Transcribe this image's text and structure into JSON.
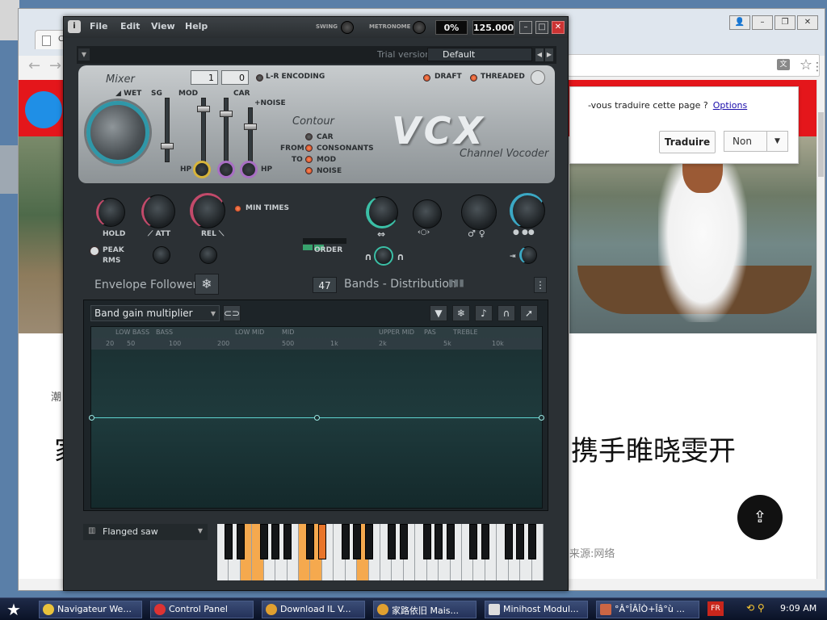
{
  "browser": {
    "tab_title": "Ch",
    "page_small_text": "潮",
    "headline_left": "家",
    "headline": "携手睢晓雯开",
    "source_text": "来源:网络",
    "translate": {
      "question": "-vous traduire cette page ?",
      "options_link": "Options",
      "translate_button": "Traduire",
      "no_button": "Non"
    }
  },
  "plugin": {
    "menu": [
      "File",
      "Edit",
      "View",
      "Help"
    ],
    "swing_label": "SWING",
    "metronome_label": "METRONOME",
    "cpu_readout": "0%",
    "tempo_readout": "125.000",
    "trial_label": "Trial version",
    "preset_name": "Default",
    "mixer": {
      "title": "Mixer",
      "wet_label": "WET",
      "sg_label": "SG",
      "mod_label": "MOD",
      "car_label": "CAR",
      "noise_label": "+NOISE",
      "hp_left": "HP",
      "hp_right": "HP",
      "num1": "1",
      "num2": "0"
    },
    "lr_encoding_label": "L-R ENCODING",
    "draft_label": "DRAFT",
    "threaded_label": "THREADED",
    "contour": {
      "title": "Contour",
      "from_label": "FROM",
      "to_label": "TO",
      "options": [
        "CAR",
        "CONSONANTS",
        "MOD",
        "NOISE"
      ]
    },
    "logo_text": "VCX",
    "logo_sub": "Channel Vocoder",
    "envelope": {
      "hold_label": "HOLD",
      "att_label": "ATT",
      "rel_label": "REL",
      "min_times_label": "MIN TIMES",
      "peak_label": "PEAK",
      "rms_label": "RMS",
      "title": "Envelope Follower"
    },
    "order_label": "ORDER",
    "bands_count": "47",
    "bands_label": "Bands - Distribution",
    "graph": {
      "dropdown": "Band gain multiplier",
      "band_names": [
        "LOW BASS",
        "BASS",
        "LOW MID",
        "MID",
        "UPPER MID",
        "PAS",
        "TREBLE"
      ],
      "freq_labels": [
        "20",
        "50",
        "100",
        "200",
        "500",
        "1k",
        "2k",
        "5k",
        "10k"
      ]
    },
    "keyboard_source": "Flanged saw"
  },
  "taskbar": {
    "items": [
      "Navigateur We...",
      "Control Panel",
      "Download IL V...",
      "家路依旧 Mais...",
      "Minihost Modul...",
      "°Â°ÎÂÎÒ+Îâ°ù ..."
    ],
    "language": "FR",
    "clock": "9:09 AM"
  },
  "colors": {
    "accent_teal": "#2f97a8",
    "led_red": "#c33d18",
    "key_highlight": "#f5a94e",
    "browser_red": "#e4161b"
  }
}
